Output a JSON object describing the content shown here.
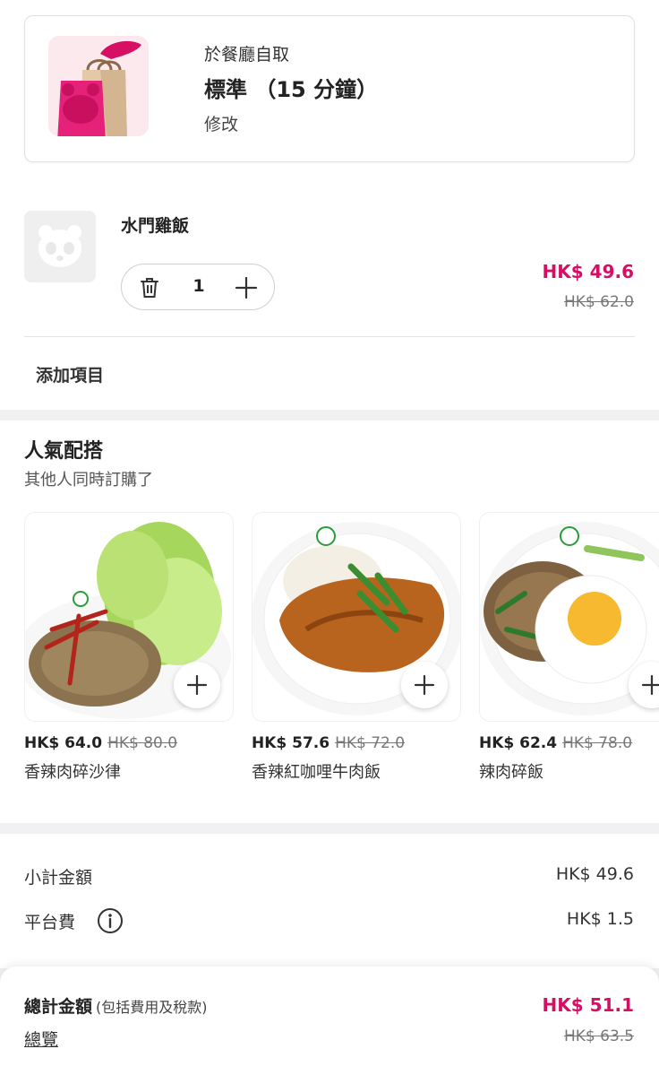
{
  "pickup": {
    "label": "於餐廳自取",
    "time": "標準 （15 分鐘）",
    "edit": "修改"
  },
  "cart_item": {
    "name": "水門雞飯",
    "quantity": "1",
    "price": "HK$ 49.6",
    "original_price": "HK$ 62.0"
  },
  "add_items_label": "添加項目",
  "recommendations": {
    "title": "人氣配搭",
    "subtitle": "其他人同時訂購了",
    "items": [
      {
        "price": "HK$ 64.0",
        "original_price": "HK$ 80.0",
        "name": "香辣肉碎沙律"
      },
      {
        "price": "HK$ 57.6",
        "original_price": "HK$ 72.0",
        "name": "香辣紅咖哩牛肉飯"
      },
      {
        "price": "HK$ 62.4",
        "original_price": "HK$ 78.0",
        "name": "辣肉碎飯"
      }
    ]
  },
  "summary": {
    "subtotal_label": "小計金額",
    "subtotal_value": "HK$ 49.6",
    "platform_fee_label": "平台費",
    "platform_fee_value": "HK$ 1.5"
  },
  "total": {
    "label": "總計金額",
    "note": "(包括費用及稅款)",
    "overview": "總覽",
    "price": "HK$ 51.1",
    "original_price": "HK$ 63.5"
  },
  "colors": {
    "accent": "#d70f64"
  }
}
